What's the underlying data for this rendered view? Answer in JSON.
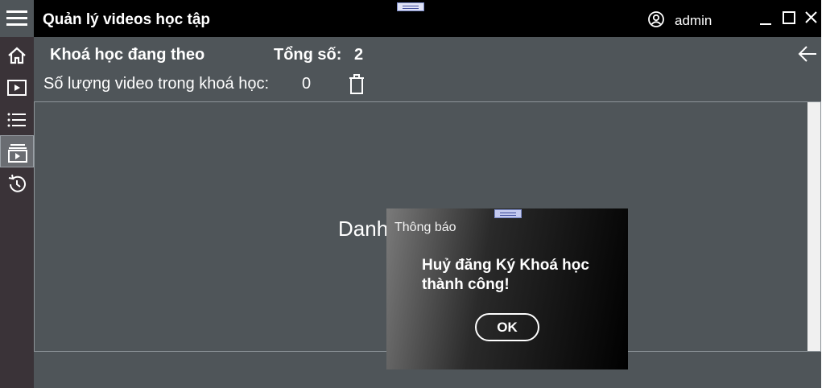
{
  "app": {
    "title": "Quản lý videos học tập",
    "username": "admin"
  },
  "header": {
    "course_label": "Khoá học đang theo",
    "total_label": "Tổng số:",
    "total_value": "2",
    "video_count_label": "Số lượng video trong khoá học:",
    "video_count_value": "0"
  },
  "main": {
    "empty_text": "Danh"
  },
  "sidebar": {
    "items": [
      "home-icon",
      "play-video-icon",
      "list-icon",
      "playlist-video-icon",
      "history-icon"
    ],
    "active_index": 3
  },
  "dialog": {
    "title": "Thông báo",
    "message": "Huỷ đăng Ký Khoá học thành công!",
    "ok_label": "OK"
  },
  "colors": {
    "titlebar": "#000000",
    "background": "#4f5559",
    "sidebar": "#3a3338"
  }
}
